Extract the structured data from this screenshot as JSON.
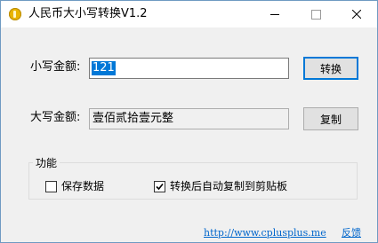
{
  "window": {
    "title": "人民币大小写转换V1.2",
    "icon": "app-coin-icon"
  },
  "form": {
    "small_label": "小写金额:",
    "small_value": "121",
    "big_label": "大写金额:",
    "big_value": "壹佰贰拾壹元整",
    "convert_button": "转换",
    "copy_button": "复制"
  },
  "options": {
    "group_title": "功能",
    "save_data": {
      "label": "保存数据",
      "checked": false
    },
    "auto_copy": {
      "label": "转换后自动复制到剪贴板",
      "checked": true
    }
  },
  "footer": {
    "site_link": "http://www.cplusplus.me",
    "feedback_link": "反馈"
  },
  "colors": {
    "accent": "#0078d7",
    "link": "#0066cc",
    "background": "#f0f0f0"
  }
}
